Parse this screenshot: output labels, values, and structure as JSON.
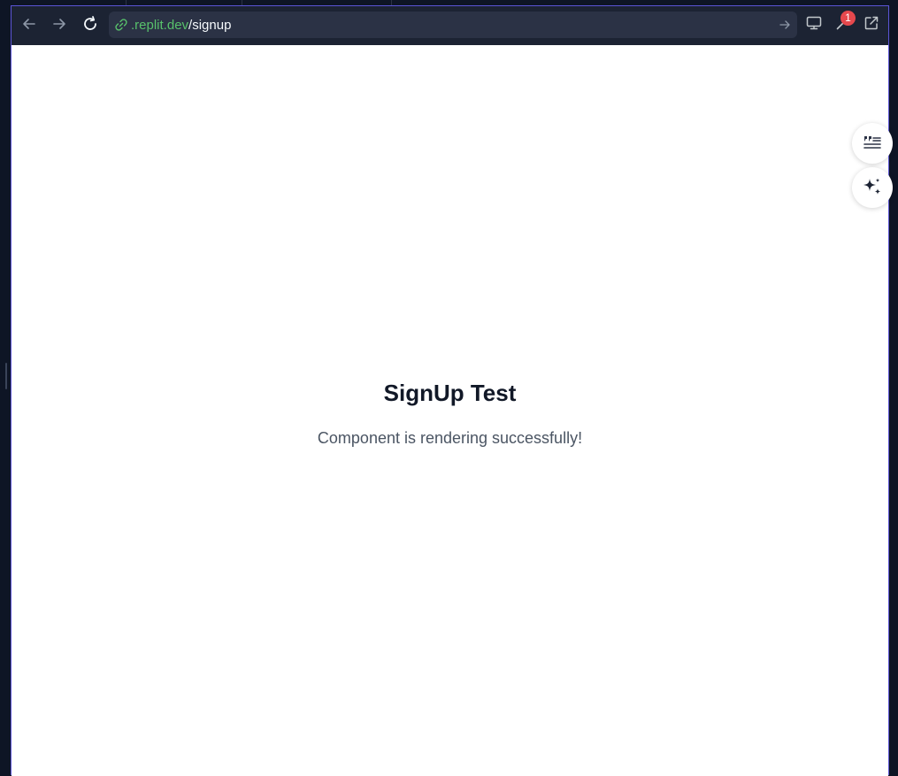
{
  "browser": {
    "url_host": ".replit.dev",
    "url_path": "/signup"
  },
  "toolbar": {
    "back_icon": "arrow-left-icon",
    "forward_icon": "arrow-right-icon",
    "reload_icon": "reload-icon",
    "go_icon": "arrow-right-icon",
    "devices_icon": "monitor-icon",
    "tools_icon": "wrench-icon",
    "tools_badge": "1",
    "open_external_icon": "external-link-icon"
  },
  "page": {
    "title": "SignUp Test",
    "subtitle": "Component is rendering successfully!"
  },
  "floating": {
    "notes_icon": "quote-lines-icon",
    "ai_icon": "sparkles-icon"
  },
  "colors": {
    "accent_border": "#5b54d6",
    "url_host": "#58c16b",
    "badge": "#e5484d"
  }
}
